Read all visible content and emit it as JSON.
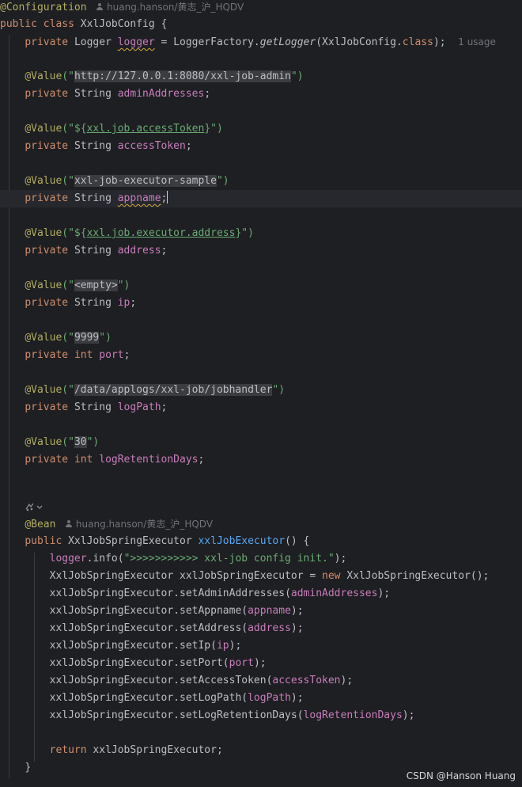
{
  "class_decl": {
    "annotation": "@Configuration",
    "author": "huang.hanson/黄志_沪_HQDV",
    "kw_public": "public",
    "kw_class": "class",
    "class_name": "XxlJobConfig",
    "open_brace": " {"
  },
  "logger_line": {
    "kw_private": "private",
    "type": "Logger",
    "name": "logger",
    "eq": " = ",
    "factory": "LoggerFactory.",
    "method": "getLogger",
    "arg_open": "(XxlJobConfig.",
    "kw_class": "class",
    "arg_close": ");",
    "usage_hint": "1 usage"
  },
  "fields": [
    {
      "annotation": "@Value",
      "open": "(\"",
      "value": "http://127.0.0.1:8080/xxl-job-admin",
      "close": "\")",
      "kw_private": "private",
      "type": "String",
      "name": "adminAddresses",
      "semi": ";"
    },
    {
      "annotation": "@Value",
      "open": "(\"${",
      "value": "xxl.job.accessToken",
      "close": "}\")",
      "kw_private": "private",
      "type": "String",
      "name": "accessToken",
      "semi": ";"
    },
    {
      "annotation": "@Value",
      "open": "(\"",
      "value": "xxl-job-executor-sample",
      "close": "\")",
      "kw_private": "private",
      "type": "String",
      "name": "appname",
      "semi": ";"
    },
    {
      "annotation": "@Value",
      "open": "(\"${",
      "value": "xxl.job.executor.address",
      "close": "}\")",
      "kw_private": "private",
      "type": "String",
      "name": "address",
      "semi": ";"
    },
    {
      "annotation": "@Value",
      "open": "(\"",
      "value": "<empty>",
      "close": "\")",
      "kw_private": "private",
      "type": "String",
      "name": "ip",
      "semi": ";"
    },
    {
      "annotation": "@Value",
      "open": "(\"",
      "value": "9999",
      "close": "\")",
      "kw_private": "private",
      "type": "int",
      "name": "port",
      "semi": ";"
    },
    {
      "annotation": "@Value",
      "open": "(\"",
      "value": "/data/applogs/xxl-job/jobhandler",
      "close": "\")",
      "kw_private": "private",
      "type": "String",
      "name": "logPath",
      "semi": ";"
    },
    {
      "annotation": "@Value",
      "open": "(\"",
      "value": "30",
      "close": "\")",
      "kw_private": "private",
      "type": "int",
      "name": "logRetentionDays",
      "semi": ";"
    }
  ],
  "bean": {
    "annotation": "@Bean",
    "author": "huang.hanson/黄志_沪_HQDV",
    "gutter_icon": "bean-gutter-icon",
    "kw_public": "public",
    "return_type": "XxlJobSpringExecutor",
    "method_name": "xxlJobExecutor",
    "signature_tail": "() {",
    "log_field": "logger",
    "log_method": ".info(",
    "log_message": "\">>>>>>>>>>> xxl-job config init.\"",
    "log_close": ");",
    "decl_type": "XxlJobSpringExecutor",
    "decl_var": " xxlJobSpringExecutor = ",
    "kw_new": "new",
    "decl_new_type": " XxlJobSpringExecutor",
    "decl_tail": "();",
    "setters": [
      {
        "receiver": "xxlJobSpringExecutor.",
        "method": "setAdminAddresses",
        "arg": "adminAddresses"
      },
      {
        "receiver": "xxlJobSpringExecutor.",
        "method": "setAppname",
        "arg": "appname"
      },
      {
        "receiver": "xxlJobSpringExecutor.",
        "method": "setAddress",
        "arg": "address"
      },
      {
        "receiver": "xxlJobSpringExecutor.",
        "method": "setIp",
        "arg": "ip"
      },
      {
        "receiver": "xxlJobSpringExecutor.",
        "method": "setPort",
        "arg": "port"
      },
      {
        "receiver": "xxlJobSpringExecutor.",
        "method": "setAccessToken",
        "arg": "accessToken"
      },
      {
        "receiver": "xxlJobSpringExecutor.",
        "method": "setLogPath",
        "arg": "logPath"
      },
      {
        "receiver": "xxlJobSpringExecutor.",
        "method": "setLogRetentionDays",
        "arg": "logRetentionDays"
      }
    ],
    "kw_return": "return",
    "return_value": " xxlJobSpringExecutor;",
    "close_brace": "}"
  },
  "watermark": "CSDN @Hanson Huang",
  "colors": {
    "background": "#1e1f22",
    "keyword": "#cf8e6d",
    "annotation": "#b3ae60",
    "string": "#6aab73",
    "field": "#c77dbb",
    "method": "#56a8f5"
  }
}
